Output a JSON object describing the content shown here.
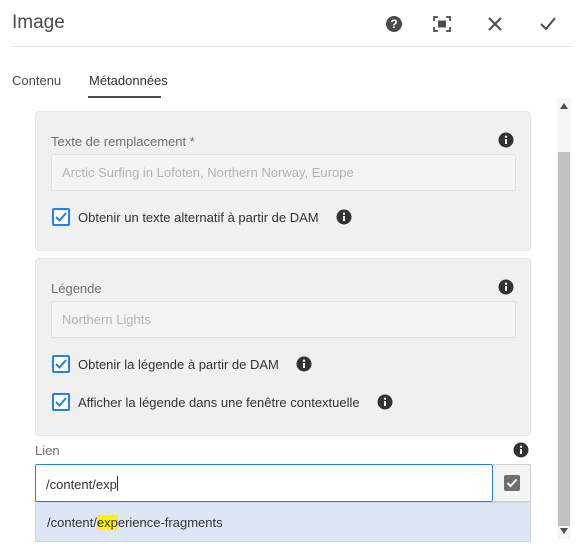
{
  "header": {
    "title": "Image",
    "icons": [
      "help-icon",
      "fullscreen-icon",
      "close-icon",
      "done-icon"
    ]
  },
  "tabs": [
    {
      "label": "Contenu",
      "active": false
    },
    {
      "label": "Métadonnées",
      "active": true
    }
  ],
  "alt_panel": {
    "label": "Texte de remplacement *",
    "value": "Arctic Surfing in Lofoten, Northern Norway, Europe",
    "checkbox_label": "Obtenir un texte alternatif à partir de DAM",
    "checked": true
  },
  "caption_panel": {
    "label": "Légende",
    "value": "Northern Lights",
    "checkbox1_label": "Obtenir la légende à partir de DAM",
    "checkbox1_checked": true,
    "checkbox2_label": "Afficher la légende dans une fenêtre contextuelle",
    "checkbox2_checked": true
  },
  "link": {
    "label": "Lien",
    "value": "/content/exp",
    "suggestion_prefix": "/content/",
    "suggestion_match": "exp",
    "suggestion_suffix": "erience-fragments"
  },
  "colors": {
    "accent": "#2680eb",
    "panel_bg": "#f0f0f0",
    "suggestion_bg": "#dde6f4",
    "highlight": "#fff200"
  }
}
